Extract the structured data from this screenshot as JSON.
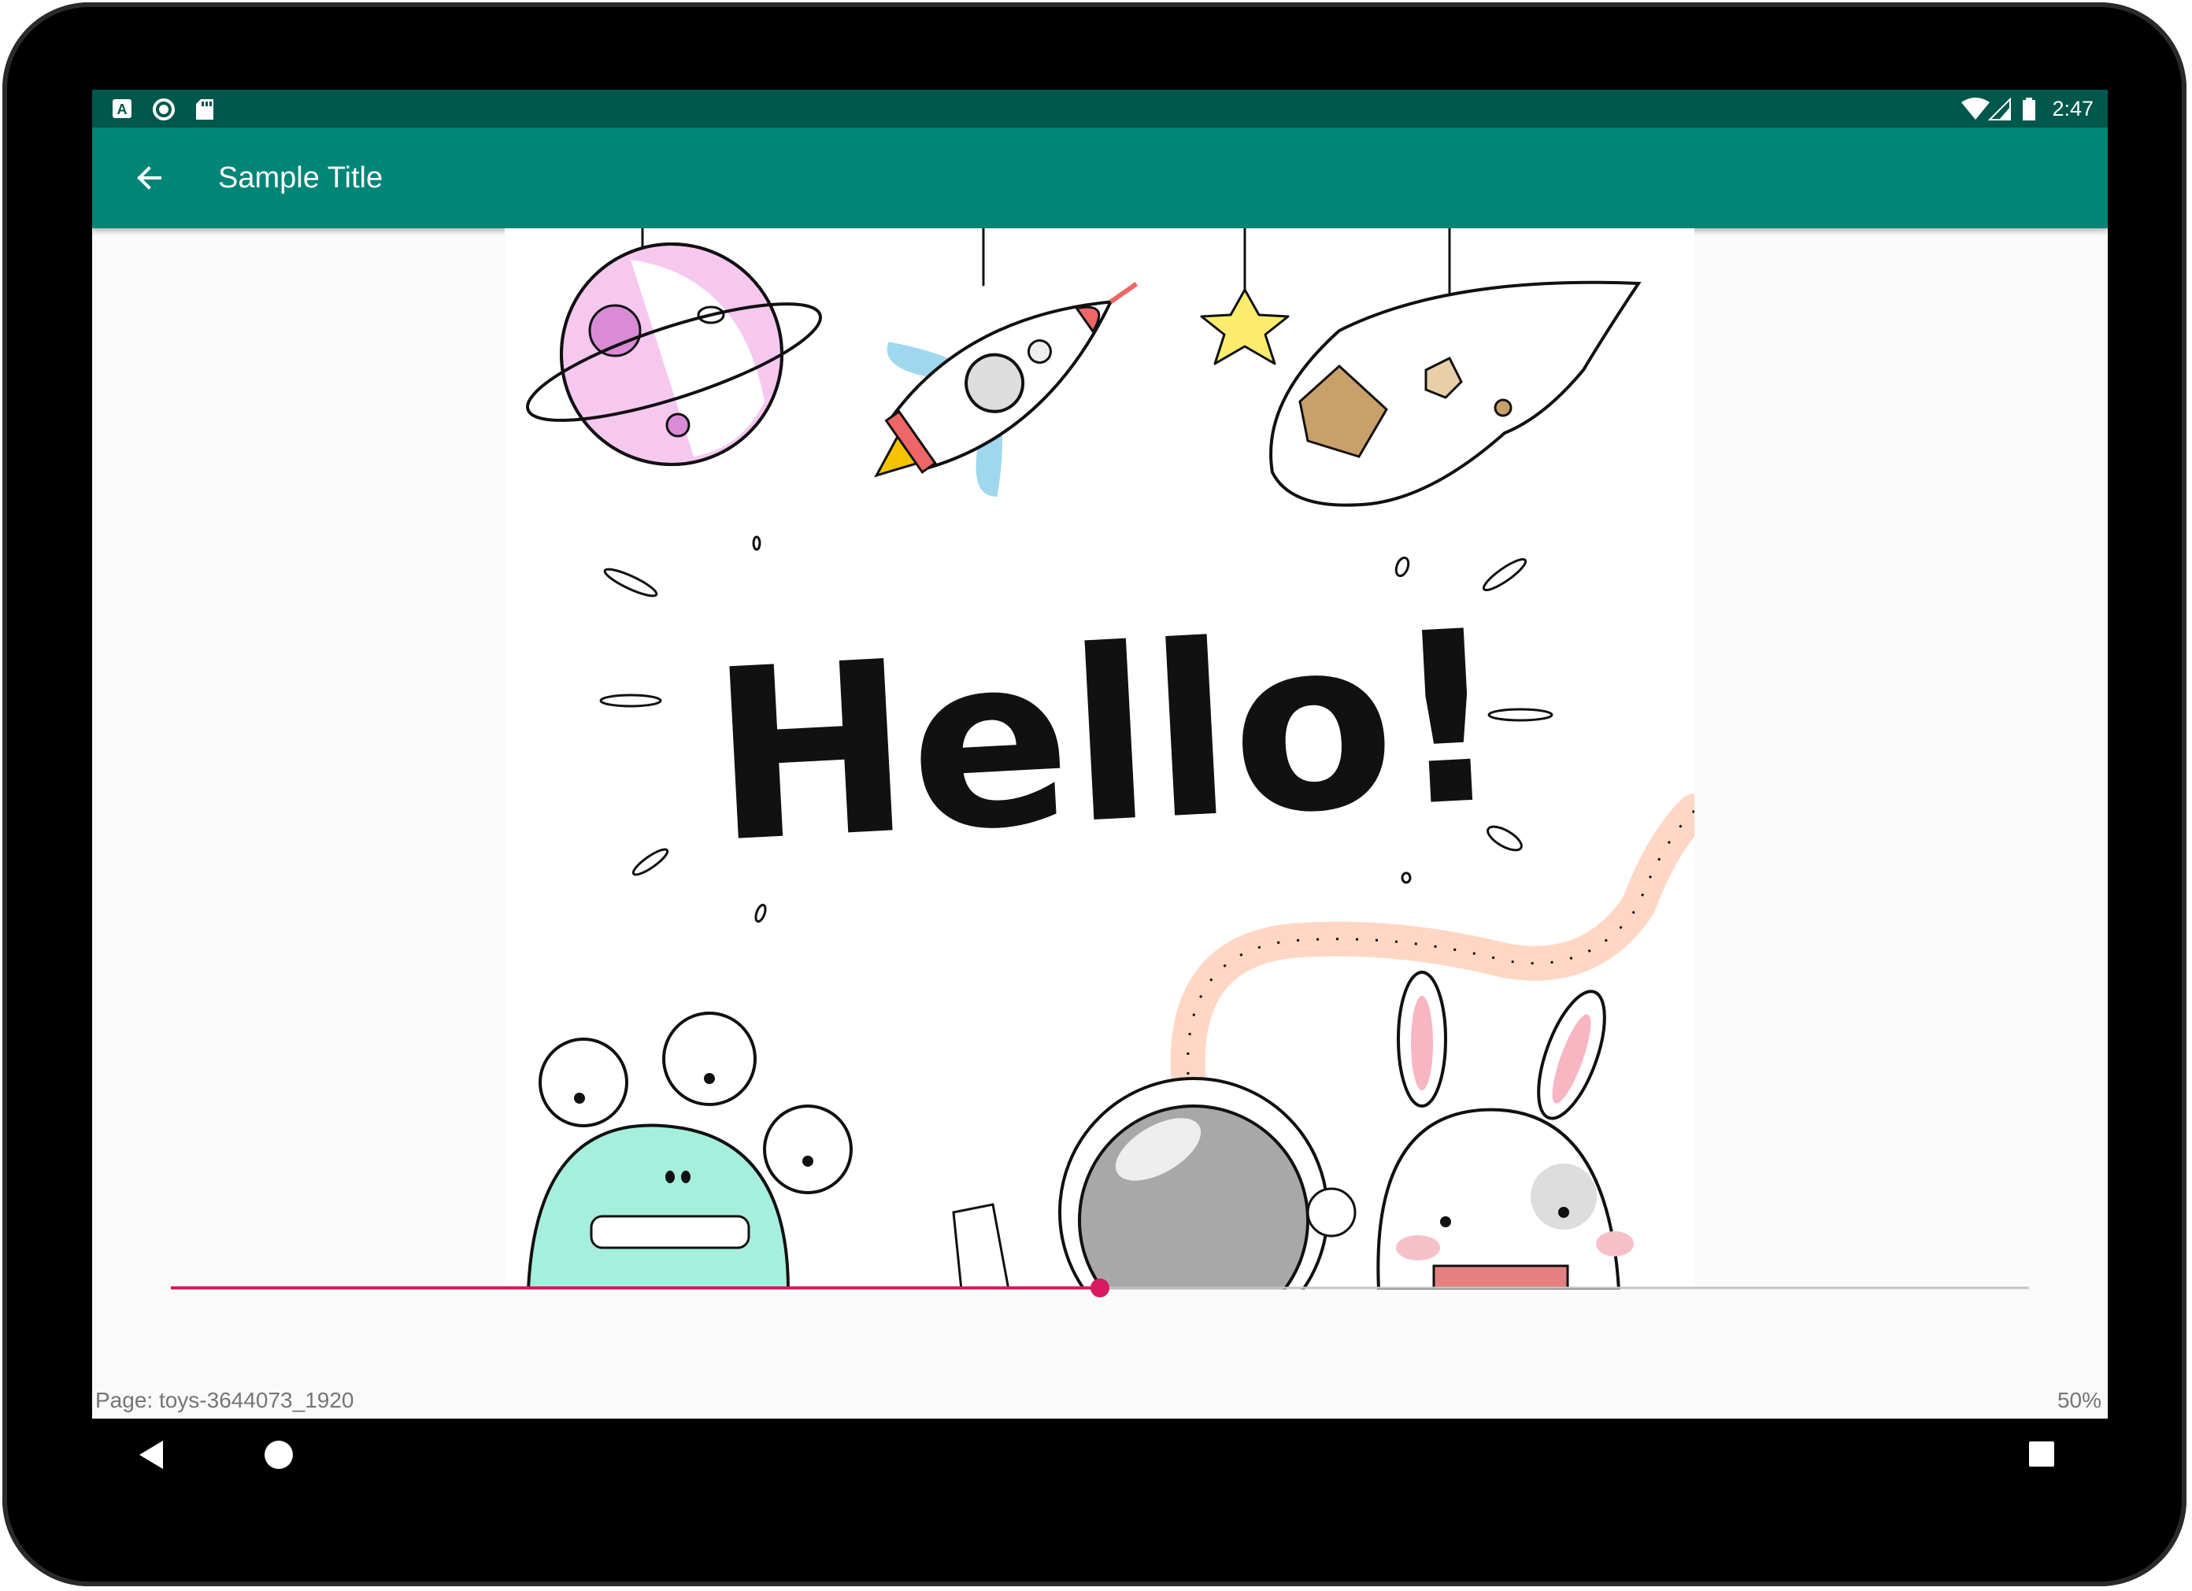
{
  "statusbar": {
    "time": "2:47",
    "left_icons": [
      "a-icon",
      "circle-icon",
      "sd-card-icon"
    ],
    "right_icons": [
      "wifi-icon",
      "signal-icon",
      "battery-icon"
    ]
  },
  "appbar": {
    "title": "Sample Title",
    "back_icon": "arrow-back-icon",
    "color": "#008577"
  },
  "illustration": {
    "text": "Hello!"
  },
  "reader": {
    "progress_fraction": 0.5,
    "page_label": "Page: toys-3644073_1920",
    "percent_label": "50%",
    "accent_color": "#d81b60"
  },
  "navbar": {
    "buttons": [
      "back-triangle-icon",
      "home-circle-icon",
      "recents-square-icon"
    ]
  }
}
